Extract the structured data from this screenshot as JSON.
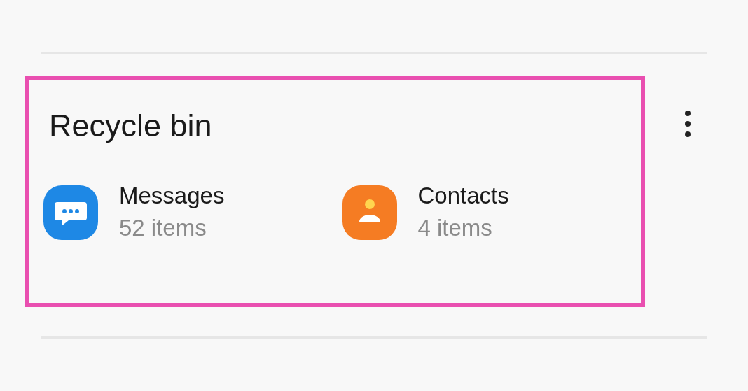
{
  "section": {
    "title": "Recycle bin",
    "highlighted": true,
    "items": [
      {
        "kind": "messages",
        "name": "Messages",
        "count": "52 items"
      },
      {
        "kind": "contacts",
        "name": "Contacts",
        "count": "4 items"
      }
    ]
  }
}
